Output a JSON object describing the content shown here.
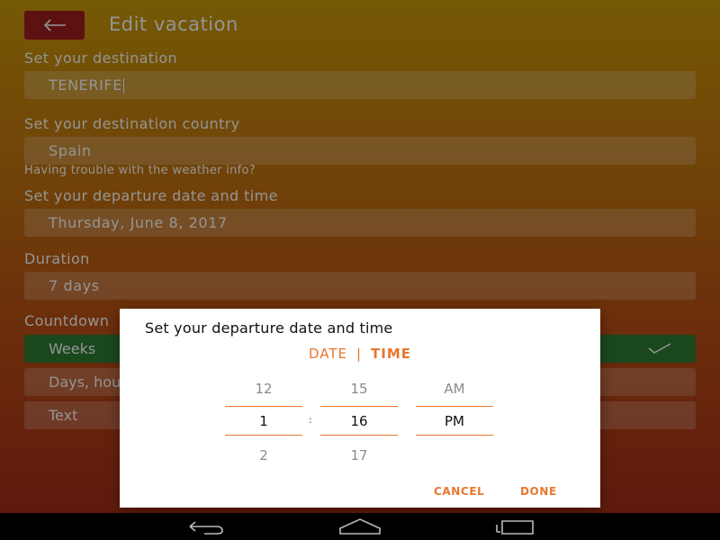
{
  "header": {
    "title": "Edit vacation"
  },
  "form": {
    "destination": {
      "label": "Set your destination",
      "value": "TENERIFE"
    },
    "country": {
      "label": "Set your destination country",
      "value": "Spain",
      "hint": "Having trouble with the weather info?"
    },
    "departure": {
      "label": "Set your departure date and time",
      "value": "Thursday, June 8, 2017"
    },
    "duration": {
      "label": "Duration",
      "value": "7 days"
    },
    "countdown": {
      "label": "Countdown",
      "options": [
        "Weeks",
        "Days, hours",
        "Text"
      ],
      "selected_index": 0
    }
  },
  "dialog": {
    "title": "Set your departure date and time",
    "tab_date": "DATE",
    "tab_separator": "|",
    "tab_time": "TIME",
    "active_tab": "time",
    "hour": {
      "prev": "12",
      "current": "1",
      "next": "2"
    },
    "minute": {
      "prev": "15",
      "current": "16",
      "next": "17"
    },
    "ampm": {
      "prev": "AM",
      "current": "PM",
      "next": ""
    },
    "colon": ":",
    "cancel_label": "CANCEL",
    "done_label": "DONE"
  },
  "navbar": {
    "icons": [
      "back-icon",
      "home-icon",
      "recents-icon"
    ]
  },
  "colors": {
    "accent": "#e8772e",
    "selected_option": "#2e7d32",
    "back_button": "#a21e1e"
  }
}
